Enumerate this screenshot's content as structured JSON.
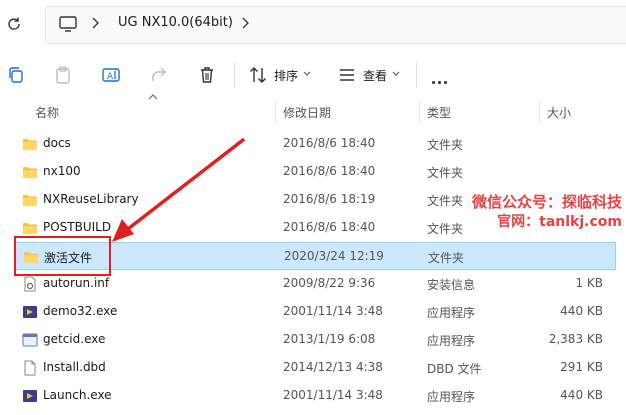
{
  "address": {
    "path_label": "UG NX10.0(64bit)"
  },
  "toolbar": {
    "sort_label": "排序",
    "view_label": "查看"
  },
  "columns": {
    "name": "名称",
    "date": "修改日期",
    "type": "类型",
    "size": "大小"
  },
  "rows": [
    {
      "name": "docs",
      "date": "2016/8/6 18:40",
      "type": "文件夹",
      "size": "",
      "icon": "folder-icon"
    },
    {
      "name": "nx100",
      "date": "2016/8/6 18:40",
      "type": "文件夹",
      "size": "",
      "icon": "folder-icon"
    },
    {
      "name": "NXReuseLibrary",
      "date": "2016/8/6 18:19",
      "type": "文件夹",
      "size": "",
      "icon": "folder-icon"
    },
    {
      "name": "POSTBUILD",
      "date": "2016/8/6 18:40",
      "type": "文件夹",
      "size": "",
      "icon": "folder-icon"
    },
    {
      "name": "激活文件",
      "date": "2020/3/24 12:19",
      "type": "文件夹",
      "size": "",
      "icon": "folder-icon",
      "selected": true
    },
    {
      "name": "autorun.inf",
      "date": "2009/8/22 9:36",
      "type": "安装信息",
      "size": "1 KB",
      "icon": "settings-file-icon"
    },
    {
      "name": "demo32.exe",
      "date": "2001/11/14 3:48",
      "type": "应用程序",
      "size": "440 KB",
      "icon": "app-icon"
    },
    {
      "name": "getcid.exe",
      "date": "2013/1/19 6:08",
      "type": "应用程序",
      "size": "2,383 KB",
      "icon": "exe-icon"
    },
    {
      "name": "Install.dbd",
      "date": "2014/12/13 4:38",
      "type": "DBD 文件",
      "size": "291 KB",
      "icon": "file-icon"
    },
    {
      "name": "Launch.exe",
      "date": "2001/11/14 3:48",
      "type": "应用程序",
      "size": "440 KB",
      "icon": "app-icon"
    }
  ],
  "watermark": {
    "line1": "微信公众号：探临科技",
    "line2": "官网：tanlkj.com"
  },
  "colors": {
    "accent_selected": "#cce8ff",
    "folder": "#f4c14a",
    "annotation_red": "#e02020"
  }
}
